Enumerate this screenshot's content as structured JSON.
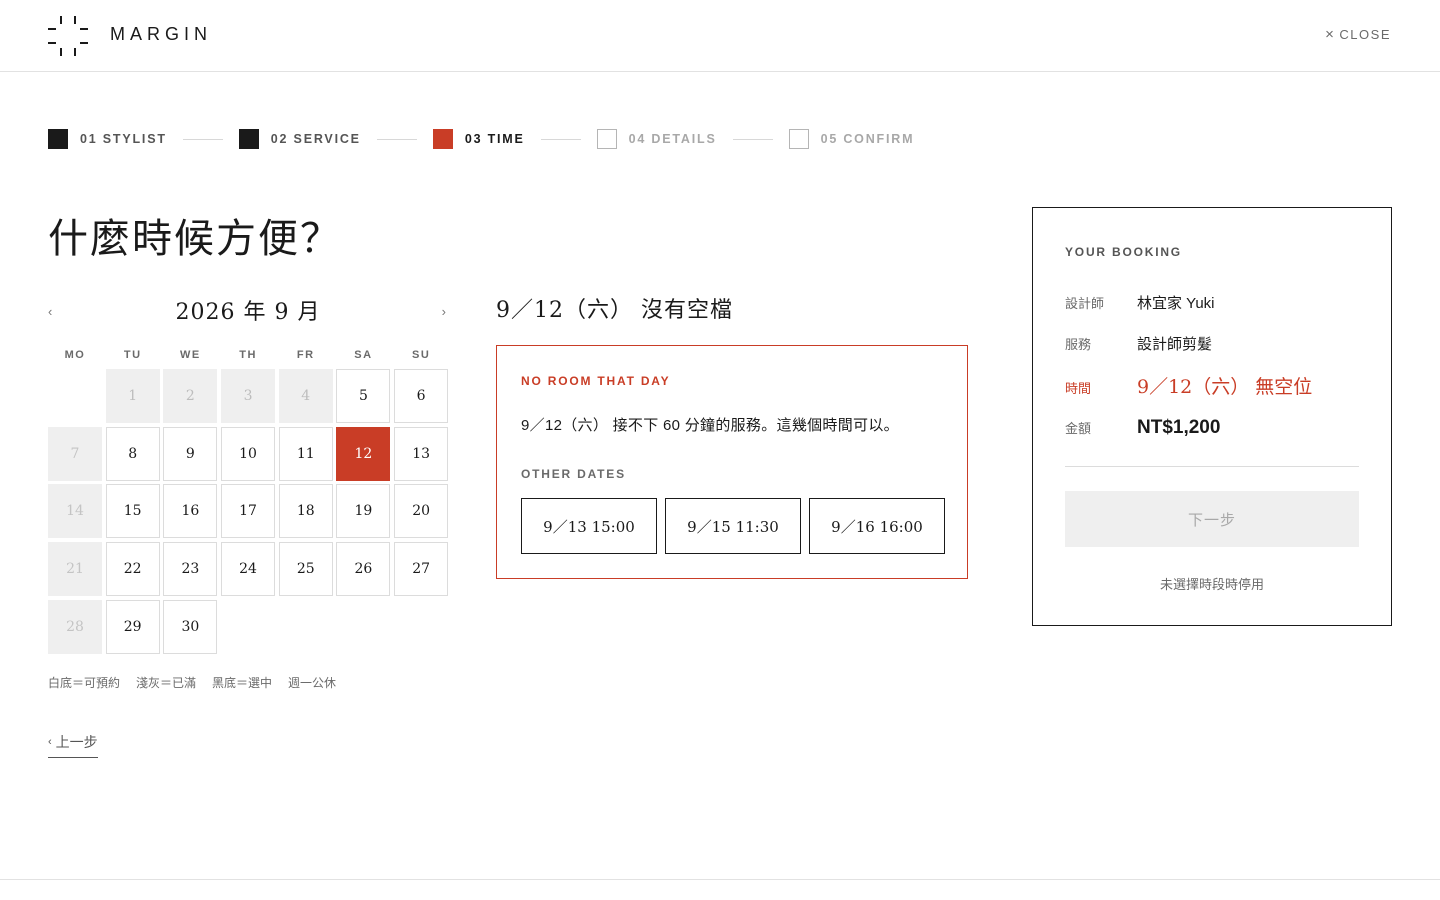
{
  "header": {
    "brand": "MARGIN",
    "close_label": "CLOSE"
  },
  "steps": [
    {
      "label": "01 STYLIST",
      "state": "done"
    },
    {
      "label": "02 SERVICE",
      "state": "done"
    },
    {
      "label": "03 TIME",
      "state": "active"
    },
    {
      "label": "04 DETAILS",
      "state": "pending"
    },
    {
      "label": "05 CONFIRM",
      "state": "pending"
    }
  ],
  "title": "什麼時候方便？",
  "calendar": {
    "prev": "‹",
    "next": "›",
    "month_label": "2026 年 9 月",
    "weekdays": [
      "MO",
      "TU",
      "WE",
      "TH",
      "FR",
      "SA",
      "SU"
    ],
    "leading_blanks": 1,
    "days": [
      {
        "d": "1",
        "s": "full"
      },
      {
        "d": "2",
        "s": "full"
      },
      {
        "d": "3",
        "s": "full"
      },
      {
        "d": "4",
        "s": "full"
      },
      {
        "d": "5",
        "s": "available"
      },
      {
        "d": "6",
        "s": "available"
      },
      {
        "d": "7",
        "s": "closed"
      },
      {
        "d": "8",
        "s": "available"
      },
      {
        "d": "9",
        "s": "available"
      },
      {
        "d": "10",
        "s": "available"
      },
      {
        "d": "11",
        "s": "available"
      },
      {
        "d": "12",
        "s": "selected"
      },
      {
        "d": "13",
        "s": "available"
      },
      {
        "d": "14",
        "s": "closed"
      },
      {
        "d": "15",
        "s": "available"
      },
      {
        "d": "16",
        "s": "available"
      },
      {
        "d": "17",
        "s": "available"
      },
      {
        "d": "18",
        "s": "available"
      },
      {
        "d": "19",
        "s": "available"
      },
      {
        "d": "20",
        "s": "available"
      },
      {
        "d": "21",
        "s": "closed"
      },
      {
        "d": "22",
        "s": "available"
      },
      {
        "d": "23",
        "s": "available"
      },
      {
        "d": "24",
        "s": "available"
      },
      {
        "d": "25",
        "s": "available"
      },
      {
        "d": "26",
        "s": "available"
      },
      {
        "d": "27",
        "s": "available"
      },
      {
        "d": "28",
        "s": "closed"
      },
      {
        "d": "29",
        "s": "available"
      },
      {
        "d": "30",
        "s": "available"
      }
    ],
    "legend": [
      "白底＝可預約",
      "淺灰＝已滿",
      "黑底＝選中",
      "週一公休"
    ]
  },
  "back_label": "上一步",
  "day_panel": {
    "heading": "9／12（六） 沒有空檔",
    "eyebrow": "NO ROOM THAT DAY",
    "message": "9／12（六） 接不下 60 分鐘的服務。這幾個時間可以。",
    "other_label": "OTHER DATES",
    "alternatives": [
      "9／13 15:00",
      "9／15 11:30",
      "9／16 16:00"
    ]
  },
  "summary": {
    "heading": "YOUR BOOKING",
    "rows": [
      {
        "key": "設計師",
        "value": "林宜家 Yuki"
      },
      {
        "key": "服務",
        "value": "設計師剪髮"
      },
      {
        "key": "時間",
        "value": "9／12（六） 無空位"
      },
      {
        "key": "金額",
        "value": "NT$1,200"
      }
    ],
    "next_label": "下一步",
    "next_hint": "未選擇時段時停用"
  },
  "colors": {
    "accent": "#c93d26",
    "ink": "#1a1a1a",
    "muted": "#6a6a6a",
    "full_bg": "#efefef"
  }
}
